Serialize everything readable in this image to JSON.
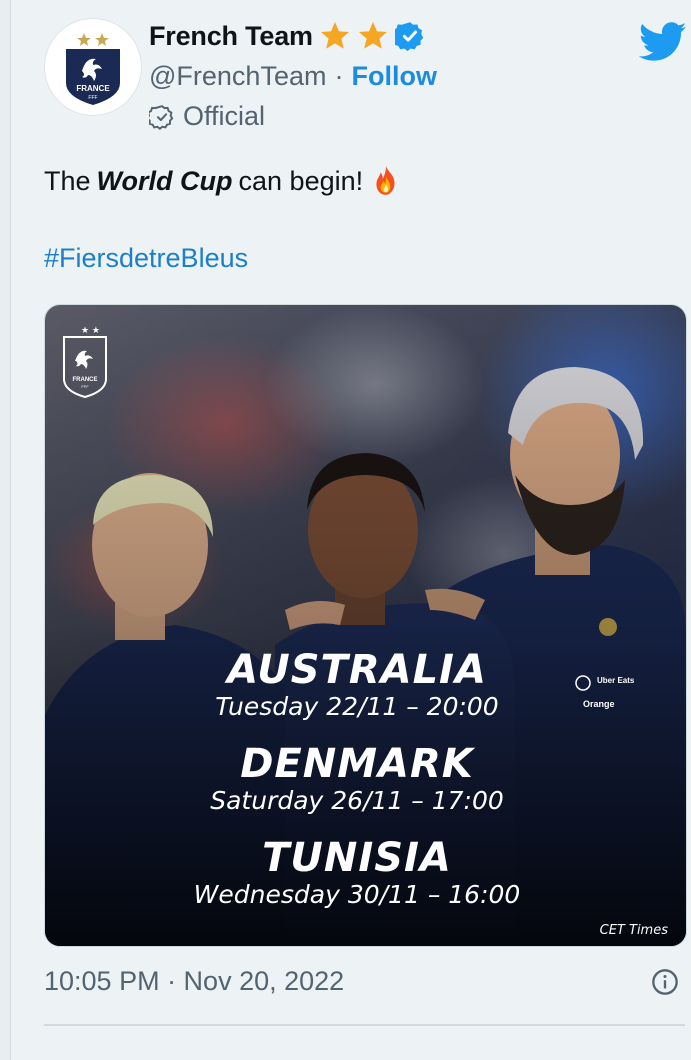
{
  "account": {
    "display_name": "French Team",
    "handle": "@FrenchTeam",
    "separator": "·",
    "follow_label": "Follow",
    "official_label": "Official",
    "avatar_text": "FRANCE",
    "avatar_subtext": "FFF"
  },
  "tweet": {
    "text_before": "The",
    "text_emphasis": "World Cup",
    "text_after": "can begin!",
    "hashtag": "#FiersdetreBleus"
  },
  "poster": {
    "badge_text": "FRANCE",
    "badge_subtext": "FFF",
    "matches": [
      {
        "opponent": "AUSTRALIA",
        "when": "Tuesday 22/11 – 20:00"
      },
      {
        "opponent": "DENMARK",
        "when": "Saturday 26/11 – 17:00"
      },
      {
        "opponent": "TUNISIA",
        "when": "Wednesday 30/11 – 16:00"
      }
    ],
    "footnote": "CET Times",
    "sponsor_1": "Uber Eats",
    "sponsor_2": "Orange"
  },
  "meta": {
    "timestamp": "10:05 PM · Nov 20, 2022"
  },
  "colors": {
    "accent": "#1d9bf0",
    "verified": "#1d9bf0",
    "star": "#f5a623",
    "kit_navy": "#1b2a55"
  },
  "icons": {
    "twitter": "twitter-bird-icon",
    "verified": "verified-badge-icon",
    "official": "official-badge-icon",
    "info": "info-icon",
    "fire": "fire-emoji-icon"
  }
}
